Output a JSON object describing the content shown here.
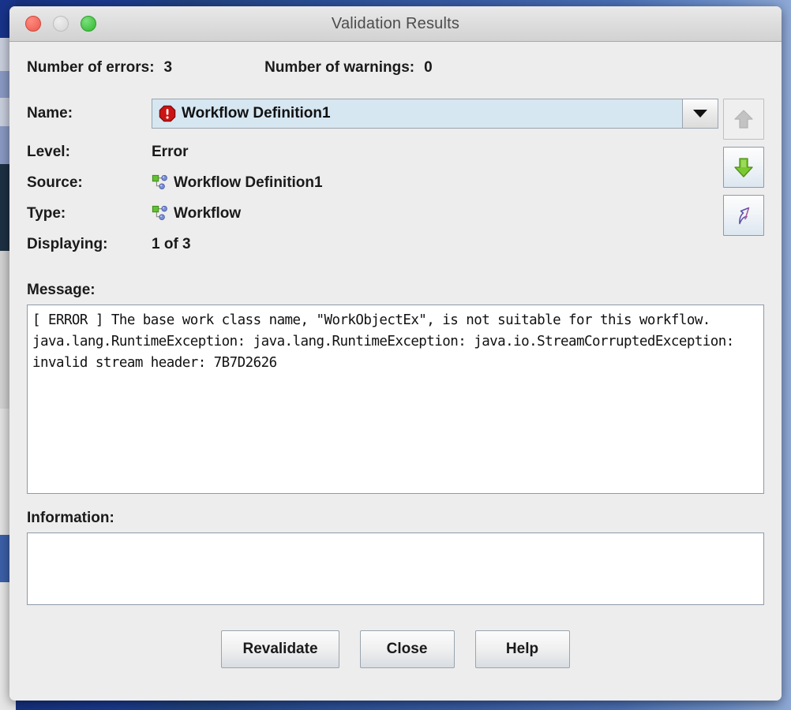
{
  "window": {
    "title": "Validation Results",
    "controls": {
      "close": "close-button",
      "minimize": "minimize-button",
      "maximize": "maximize-button"
    }
  },
  "summary": {
    "errors_label": "Number of errors:",
    "errors_value": "3",
    "warnings_label": "Number of warnings:",
    "warnings_value": "0"
  },
  "fields": {
    "name_label": "Name:",
    "name_value": "Workflow Definition1",
    "level_label": "Level:",
    "level_value": "Error",
    "source_label": "Source:",
    "source_value": "Workflow Definition1",
    "type_label": "Type:",
    "type_value": "Workflow",
    "displaying_label": "Displaying:",
    "displaying_value": "1 of 3"
  },
  "navigation": {
    "previous_label": "Previous error",
    "next_label": "Next error",
    "goto_label": "Go to source"
  },
  "message": {
    "label": "Message:",
    "text": "[ ERROR ] The base work class name, \"WorkObjectEx\", is not suitable for this workflow. java.lang.RuntimeException: java.lang.RuntimeException: java.io.StreamCorruptedException: invalid stream header: 7B7D2626"
  },
  "information": {
    "label": "Information:",
    "text": ""
  },
  "footer": {
    "revalidate_label": "Revalidate",
    "close_label": "Close",
    "help_label": "Help"
  },
  "colors": {
    "error_red": "#cc1414",
    "workflow_green": "#62c132",
    "workflow_node_blue": "#7b8fd4",
    "combo_background": "#d6e7f2",
    "dialog_background": "#ededed",
    "desktop_blue": "#1b3a8f",
    "next_arrow_green": "#7cc832",
    "disabled_arrow_gray": "#c3c3c3"
  }
}
